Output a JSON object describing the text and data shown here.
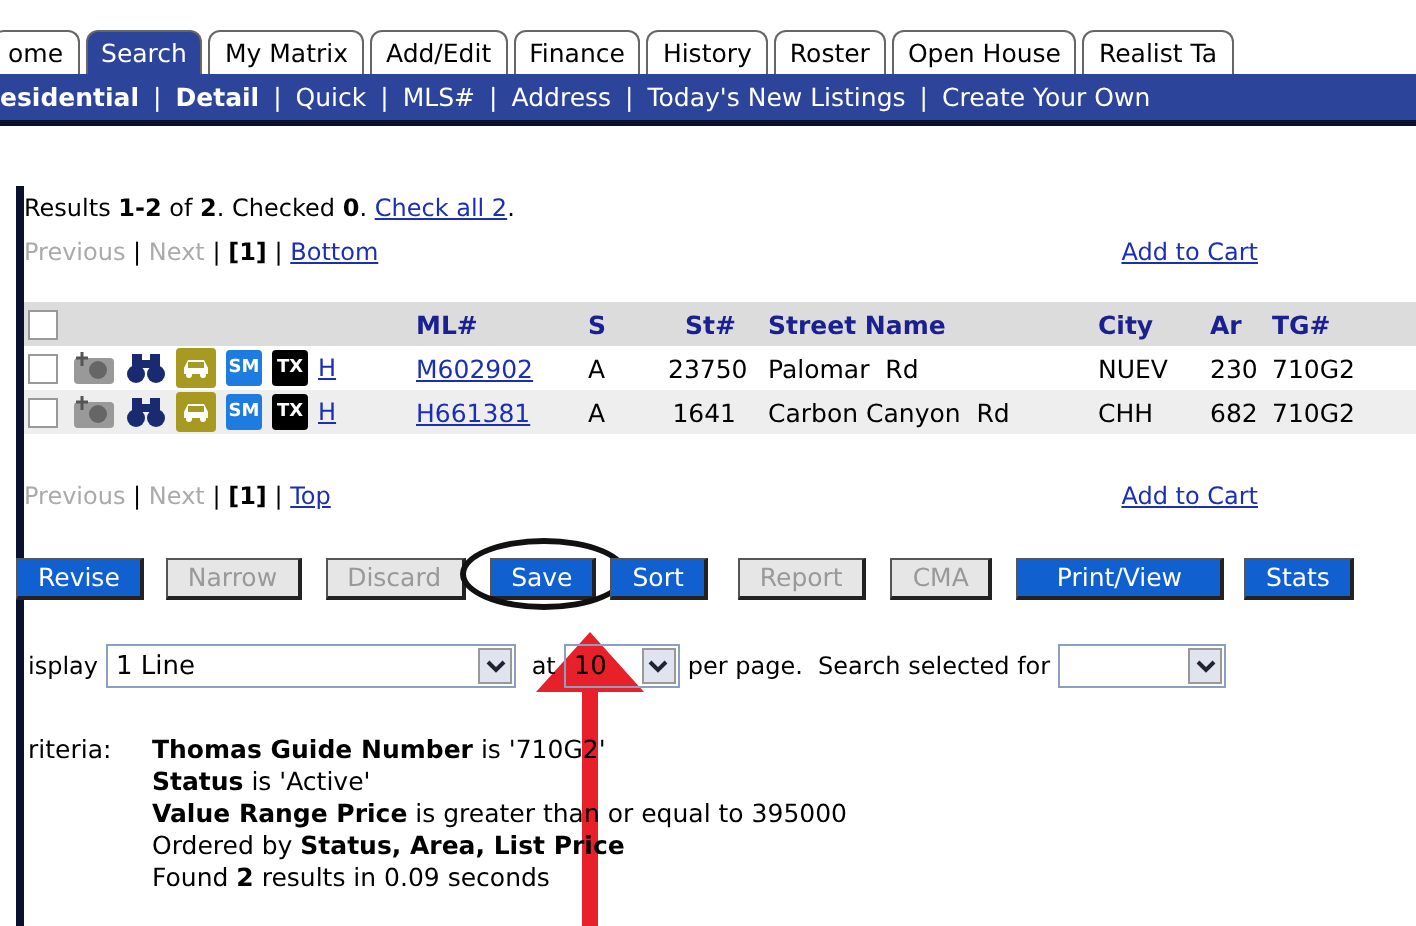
{
  "tabs": [
    {
      "label": "ome",
      "selected": false
    },
    {
      "label": "Search",
      "selected": true
    },
    {
      "label": "My Matrix",
      "selected": false
    },
    {
      "label": "Add/Edit",
      "selected": false
    },
    {
      "label": "Finance",
      "selected": false
    },
    {
      "label": "History",
      "selected": false
    },
    {
      "label": "Roster",
      "selected": false
    },
    {
      "label": "Open House",
      "selected": false
    },
    {
      "label": "Realist Ta",
      "selected": false
    }
  ],
  "subnav": {
    "separator": "|",
    "items": [
      {
        "label": "esidential",
        "selected": true
      },
      {
        "label": "Detail",
        "selected": true
      },
      {
        "label": "Quick",
        "selected": false
      },
      {
        "label": "MLS#",
        "selected": false
      },
      {
        "label": "Address",
        "selected": false
      },
      {
        "label": "Today's New Listings",
        "selected": false
      },
      {
        "label": "Create Your Own",
        "selected": false
      }
    ]
  },
  "results": {
    "summary": "Results **1-2** of **2**. Checked **0**.",
    "check_all": "Check all 2",
    "after": "."
  },
  "pager_top": {
    "separator": "|",
    "items": [
      {
        "label": "Previous",
        "kind": "disabled"
      },
      {
        "label": "Next",
        "kind": "disabled"
      },
      {
        "label": "[1]",
        "kind": "current"
      },
      {
        "label": "Bottom",
        "kind": "link"
      }
    ],
    "cart": "Add to Cart"
  },
  "table": {
    "select_all_checked": false,
    "columns": [
      "ML#",
      "S",
      "St#",
      "Street Name",
      "City",
      "Ar",
      "TG#"
    ],
    "rows": [
      {
        "checked": false,
        "badges": [
          "SM",
          "TX"
        ],
        "link": "H",
        "cells": [
          "M602902",
          "A",
          "23750",
          "Palomar  Rd",
          "NUEV",
          "230",
          "710G2"
        ]
      },
      {
        "checked": false,
        "badges": [
          "SM",
          "TX"
        ],
        "link": "H",
        "cells": [
          "H661381",
          "A",
          "1641",
          "Carbon Canyon  Rd",
          "CHH",
          "682",
          "710G2"
        ]
      }
    ]
  },
  "pager_bottom": {
    "separator": "|",
    "items": [
      {
        "label": "Previous",
        "kind": "disabled"
      },
      {
        "label": "Next",
        "kind": "disabled"
      },
      {
        "label": "[1]",
        "kind": "current"
      },
      {
        "label": "Top",
        "kind": "link"
      }
    ],
    "cart": "Add to Cart"
  },
  "buttons": [
    {
      "label": "Revise",
      "disabled": false,
      "circled": false
    },
    {
      "label": "Narrow",
      "disabled": true,
      "circled": false
    },
    {
      "label": "Discard",
      "disabled": true,
      "circled": false
    },
    {
      "label": "Save",
      "disabled": false,
      "circled": true
    },
    {
      "label": "Sort",
      "disabled": false,
      "circled": false
    },
    {
      "label": "Report",
      "disabled": true,
      "circled": false
    },
    {
      "label": "CMA",
      "disabled": true,
      "circled": false
    },
    {
      "label": "Print/View",
      "disabled": false,
      "circled": false
    },
    {
      "label": "Stats",
      "disabled": false,
      "circled": false
    }
  ],
  "display": {
    "label": "isplay",
    "format": "1 Line",
    "at": "at",
    "count": "10",
    "per_page": "per page.  Search selected for"
  },
  "criteria": {
    "label": "riteria:",
    "lines": [
      "**Thomas Guide Number** is '710G2'",
      "**Status** is 'Active'",
      "**Value Range Price** is greater than or equal to 395000",
      "Ordered by **Status, Area, List Price**",
      "Found **2** results in 0.09 seconds"
    ]
  }
}
